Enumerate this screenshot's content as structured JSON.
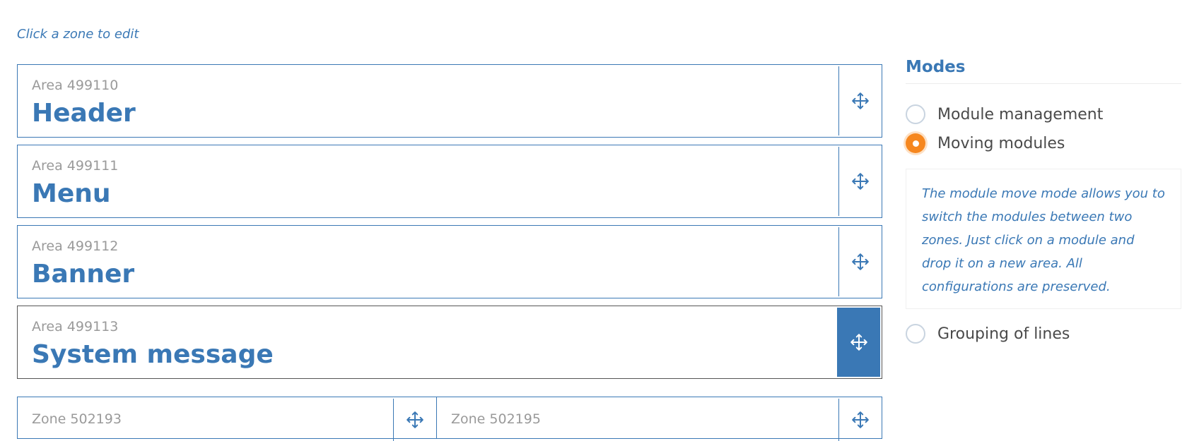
{
  "hint": "Click a zone to edit",
  "areas": [
    {
      "sub": "Area 499110",
      "title": "Header"
    },
    {
      "sub": "Area 499111",
      "title": "Menu"
    },
    {
      "sub": "Area 499112",
      "title": "Banner"
    },
    {
      "sub": "Area 499113",
      "title": "System message"
    }
  ],
  "zones": [
    {
      "sub": "Zone 502193"
    },
    {
      "sub": "Zone 502195"
    }
  ],
  "modes": {
    "title": "Modes",
    "options": [
      {
        "label": "Module management",
        "checked": false
      },
      {
        "label": "Moving modules",
        "checked": true
      },
      {
        "label": "Grouping of lines",
        "checked": false
      }
    ],
    "description": "The module move mode allows you to switch the modules between two zones. Just click on a module and drop it on a new area. All configurations are preserved."
  },
  "colors": {
    "accent": "#3a78b5",
    "radio_selected": "#f6871f"
  },
  "icons": {
    "handle": "move-arrows-icon"
  }
}
